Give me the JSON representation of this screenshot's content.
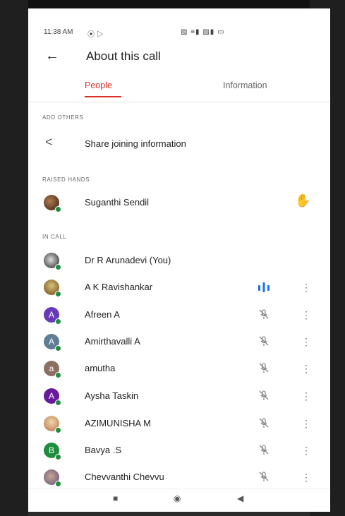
{
  "status": {
    "time": "11:38 AM",
    "left_icons": "⦿ ▷",
    "right_icons": "▨ ≡▮ ▨▮ ▭"
  },
  "appbar": {
    "title": "About this call",
    "back_icon": "←"
  },
  "tabs": [
    {
      "label": "People"
    },
    {
      "label": "Information"
    }
  ],
  "sections": {
    "add_others": "ADD OTHERS",
    "raised_hands": "RAISED HANDS",
    "in_call": "IN CALL"
  },
  "share": {
    "label": "Share joining information",
    "icon": "<"
  },
  "raised": {
    "name": "Suganthi Sendil",
    "hand_icon": "✋"
  },
  "participants": [
    {
      "name": "Dr R Arunadevi (You)",
      "avatar": "",
      "color": "",
      "mic": "",
      "more": ""
    },
    {
      "name": "A K Ravishankar",
      "avatar": "",
      "color": "",
      "mic": "speaking",
      "more": "⋮"
    },
    {
      "name": "Afreen A",
      "avatar": "A",
      "color": "#673ab7",
      "mic": "̶🎙",
      "more": "⋮"
    },
    {
      "name": "Amirthavalli A",
      "avatar": "A",
      "color": "#5f7d95",
      "mic": "̶🎙",
      "more": "⋮"
    },
    {
      "name": "amutha",
      "avatar": "a",
      "color": "#8d6e63",
      "mic": "̶🎙",
      "more": "⋮"
    },
    {
      "name": "Aysha Taskin",
      "avatar": "A",
      "color": "#6a1b9a",
      "mic": "̶🎙",
      "more": "⋮"
    },
    {
      "name": "AZIMUNISHA M",
      "avatar": "",
      "color": "",
      "mic": "̶🎙",
      "more": "⋮"
    },
    {
      "name": "Bavya .S",
      "avatar": "B",
      "color": "#1e8e3e",
      "mic": "̶🎙",
      "more": "⋮"
    },
    {
      "name": "Chevvanthi Chevvu",
      "avatar": "",
      "color": "",
      "mic": "̶🎙",
      "more": "⋮"
    }
  ],
  "nav": {
    "recents": "■",
    "home": "◉",
    "back": "◀"
  },
  "colors": {
    "accent": "#d93025",
    "speaking": "#1a73e8",
    "online": "#1e8e3e"
  }
}
